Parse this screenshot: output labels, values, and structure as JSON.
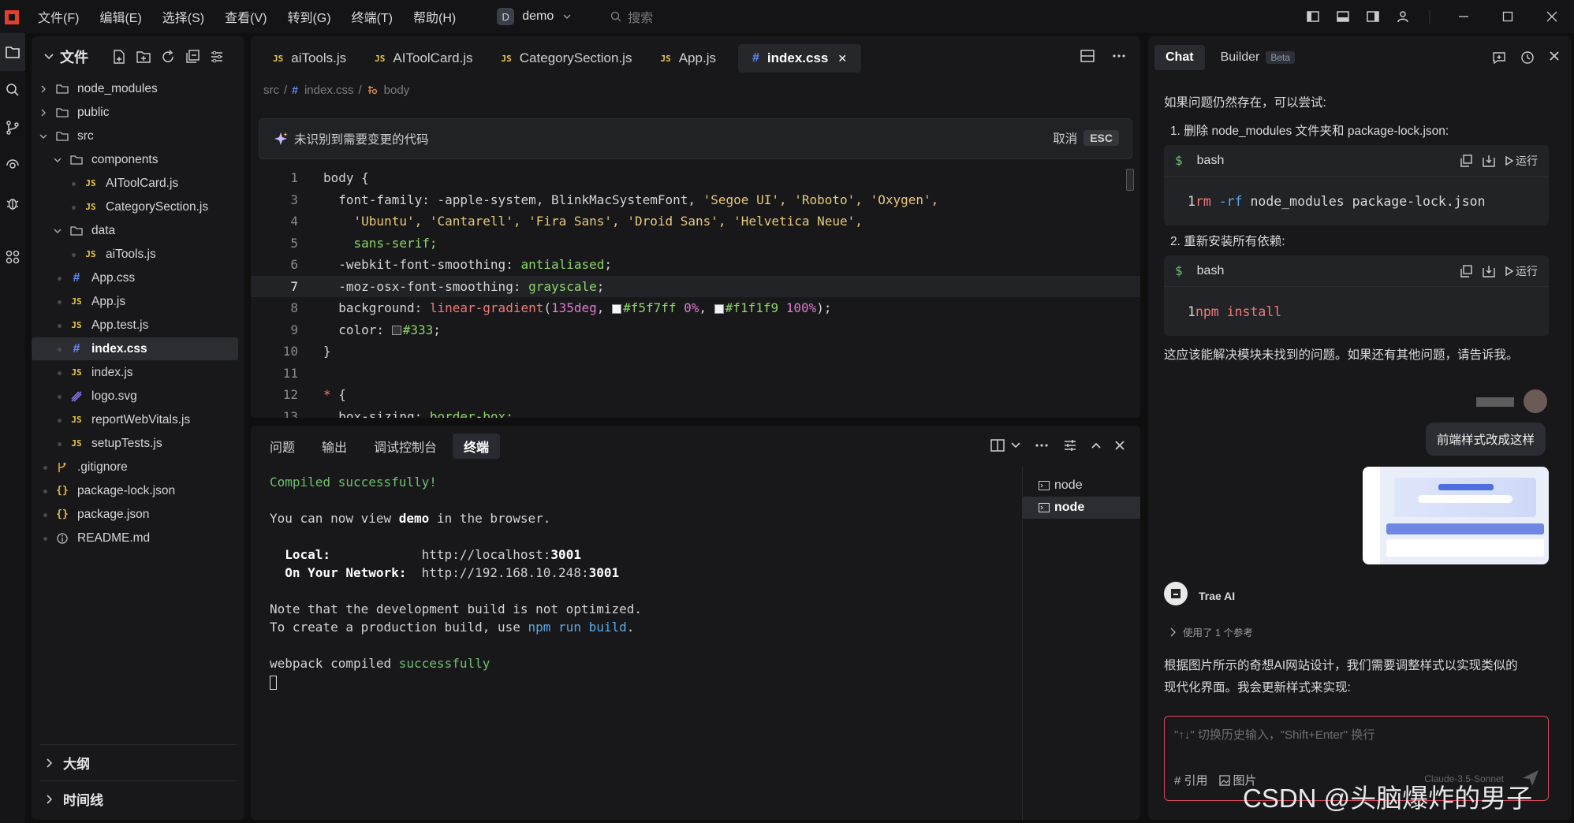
{
  "titlebar": {
    "menus": [
      "文件(F)",
      "编辑(E)",
      "选择(S)",
      "查看(V)",
      "转到(G)",
      "终端(T)",
      "帮助(H)"
    ],
    "project_badge": "D",
    "project_name": "demo",
    "search_placeholder": "搜索"
  },
  "explorer": {
    "title": "文件",
    "items": [
      {
        "label": "node_modules",
        "kind": "folder",
        "open": false,
        "depth": 0
      },
      {
        "label": "public",
        "kind": "folder",
        "open": false,
        "depth": 0
      },
      {
        "label": "src",
        "kind": "folder",
        "open": true,
        "depth": 0
      },
      {
        "label": "components",
        "kind": "folder",
        "open": true,
        "depth": 1
      },
      {
        "label": "AIToolCard.js",
        "kind": "js",
        "depth": 2
      },
      {
        "label": "CategorySection.js",
        "kind": "js",
        "depth": 2
      },
      {
        "label": "data",
        "kind": "folder",
        "open": true,
        "depth": 1
      },
      {
        "label": "aiTools.js",
        "kind": "js",
        "depth": 2
      },
      {
        "label": "App.css",
        "kind": "css",
        "depth": 1
      },
      {
        "label": "App.js",
        "kind": "js",
        "depth": 1
      },
      {
        "label": "App.test.js",
        "kind": "js",
        "depth": 1
      },
      {
        "label": "index.css",
        "kind": "css",
        "depth": 1,
        "selected": true
      },
      {
        "label": "index.js",
        "kind": "js",
        "depth": 1
      },
      {
        "label": "logo.svg",
        "kind": "svg",
        "depth": 1
      },
      {
        "label": "reportWebVitals.js",
        "kind": "js",
        "depth": 1
      },
      {
        "label": "setupTests.js",
        "kind": "js",
        "depth": 1
      },
      {
        "label": ".gitignore",
        "kind": "git",
        "depth": 0
      },
      {
        "label": "package-lock.json",
        "kind": "json",
        "depth": 0
      },
      {
        "label": "package.json",
        "kind": "json",
        "depth": 0
      },
      {
        "label": "README.md",
        "kind": "info",
        "depth": 0
      }
    ],
    "outline_label": "大纲",
    "timeline_label": "时间线"
  },
  "editor": {
    "tabs": [
      {
        "label": "aiTools.js",
        "kind": "js"
      },
      {
        "label": "AIToolCard.js",
        "kind": "js"
      },
      {
        "label": "CategorySection.js",
        "kind": "js"
      },
      {
        "label": "App.js",
        "kind": "js"
      },
      {
        "label": "index.css",
        "kind": "css",
        "active": true
      }
    ],
    "close_glyph": "✕",
    "breadcrumb": {
      "a": "src",
      "b": "index.css",
      "c": "body",
      "sep": "/"
    },
    "notice": "未识别到需要变更的代码",
    "notice_cancel": "取消",
    "notice_key": "ESC",
    "line_numbers": [
      "1",
      "3",
      "4",
      "5",
      "6",
      "7",
      "8",
      "9",
      "10",
      "11",
      "12",
      "13"
    ],
    "current_line": "7",
    "code": {
      "l1": "body {",
      "l3_prop": "  font-family: -apple-system, BlinkMacSystemFont, ",
      "l3_s": "'Segoe UI', 'Roboto', 'Oxygen',",
      "l4_s": "    'Ubuntu', 'Cantarell', 'Fira Sans', 'Droid Sans', 'Helvetica Neue',",
      "l5": "    sans-serif;",
      "l6_prop": "  -webkit-font-smoothing: ",
      "l6_val": "antialiased",
      "l7_prop": "  -moz-osx-font-smoothing: ",
      "l7_val": "grayscale",
      "l8_prop": "  background: ",
      "l8_fn": "linear-gradient",
      "l8_a": "(",
      "l8_deg": "135deg",
      "l8_c1": "#f5f7ff",
      "l8_p1": "0%",
      "l8_c2": "#f1f1f9",
      "l8_p2": "100%",
      "l8_end": ");",
      "l9_prop": "  color: ",
      "l9_val": "#333",
      "semicolon": ";",
      "comma_sp": ", ",
      "sp": " ",
      "l10": "}",
      "l12_star": "* ",
      "l12_brace": "{",
      "l13_prop": "  box-sizing: ",
      "l13_val": "border-box;"
    }
  },
  "terminal": {
    "tabs": [
      "问题",
      "输出",
      "调试控制台",
      "终端"
    ],
    "active_tab": "终端",
    "lines": {
      "compiled": "Compiled successfully!",
      "view_a": "You can now view ",
      "view_b": "demo",
      "view_c": " in the browser.",
      "local_label": "  Local:",
      "local_url_a": "            http://localhost:",
      "local_port": "3001",
      "net_label": "  On Your Network:",
      "net_url_a": "  http://192.168.10.248:",
      "net_port": "3001",
      "note1": "Note that the development build is not optimized.",
      "note2_a": "To create a production build, use ",
      "note2_b": "npm run build",
      "note2_c": ".",
      "webpack_a": "webpack compiled ",
      "webpack_b": "successfully"
    },
    "sessions": [
      "node",
      "node"
    ]
  },
  "chat": {
    "tab_chat": "Chat",
    "tab_builder": "Builder",
    "beta": "Beta",
    "msg_intro": "如果问题仍然存在，可以尝试:",
    "step1": "1. 删除 node_modules 文件夹和 package-lock.json:",
    "step2": "2. 重新安装所有依赖:",
    "code1": {
      "lang": "bash",
      "line": "1",
      "cmd_a": "rm",
      "cmd_b": " -rf",
      "cmd_c": " node_modules package-lock.json"
    },
    "code2": {
      "lang": "bash",
      "line": "1",
      "cmd_a": "npm",
      "cmd_b": " install"
    },
    "run_label": "运行",
    "dollar": "$",
    "msg_outro": "这应该能解决模块未找到的问题。如果还有其他问题，请告诉我。",
    "user_msg": "前端样式改成这样",
    "ai_name": "Trae AI",
    "refs": "使用了 1 个参考",
    "ai_reply_1": "根据图片所示的奇想AI网站设计，我们需要调整样式以实现类似的",
    "ai_reply_2": "现代化界面。我会更新样式来实现:",
    "input_placeholder": "\"↑↓\" 切换历史输入，\"Shift+Enter\" 换行",
    "ref_btn": "# 引用",
    "image_btn": "图片",
    "model": "Claude-3.5-Sonnet"
  },
  "watermark": "CSDN @头脑爆炸的男子"
}
